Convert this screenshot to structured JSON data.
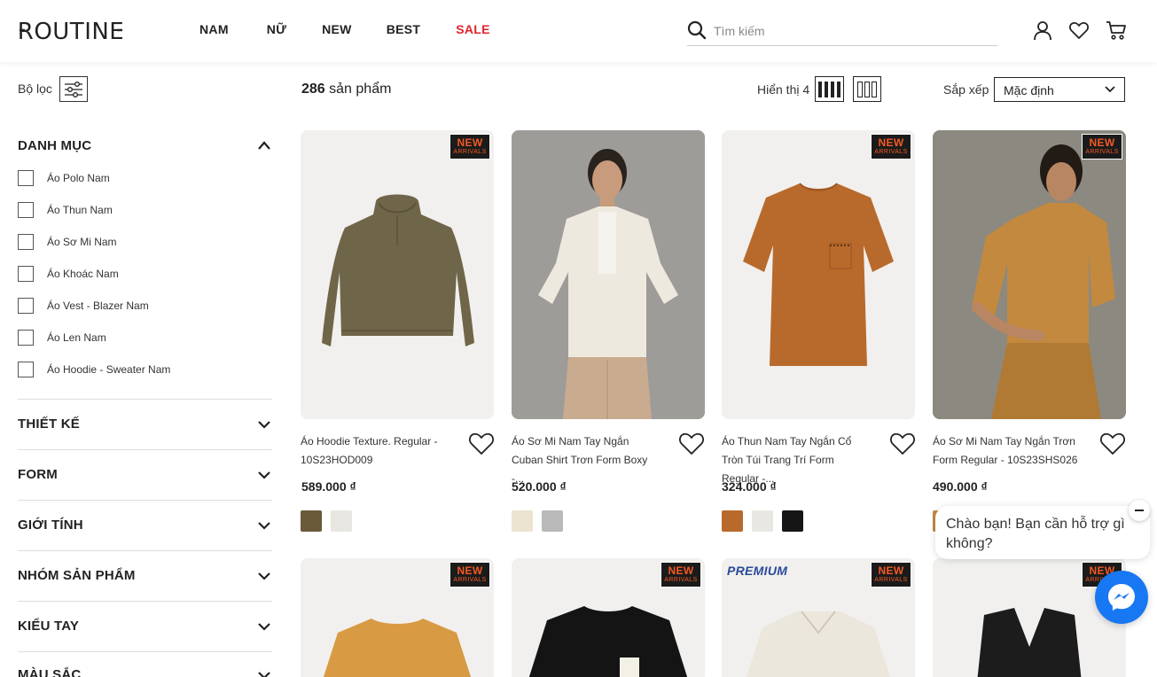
{
  "header": {
    "logo": "ROUTINE",
    "nav": [
      {
        "label": "NAM"
      },
      {
        "label": "NỮ"
      },
      {
        "label": "NEW"
      },
      {
        "label": "BEST"
      },
      {
        "label": "SALE",
        "color": "#e0242c"
      }
    ],
    "search_placeholder": "Tìm kiếm"
  },
  "toolbar": {
    "filter_label": "Bộ lọc",
    "count_number": "286",
    "count_suffix": " sản phẩm",
    "display_label": "Hiển thị 4",
    "sort_label": "Sắp xếp",
    "sort_value": "Mặc định"
  },
  "sidebar": {
    "category_title": "DANH MỤC",
    "categories": [
      {
        "label": "Áo Polo Nam"
      },
      {
        "label": "Áo Thun Nam"
      },
      {
        "label": "Áo Sơ Mi Nam"
      },
      {
        "label": "Áo Khoác Nam"
      },
      {
        "label": "Áo Vest - Blazer Nam"
      },
      {
        "label": "Áo Len Nam"
      },
      {
        "label": "Áo Hoodie - Sweater Nam"
      }
    ],
    "sections": [
      {
        "title": "THIẾT KẾ"
      },
      {
        "title": "FORM"
      },
      {
        "title": "GIỚI TÍNH"
      },
      {
        "title": "NHÓM SẢN PHẨM"
      },
      {
        "title": "KIỂU TAY"
      },
      {
        "title": "MÀU SẮC"
      }
    ]
  },
  "badge": {
    "line1": "NEW",
    "line2": "ARRIVALS",
    "premium": "PREMIUM"
  },
  "products": [
    {
      "name": "Áo Hoodie Texture. Regular - 10S23HOD009",
      "price": "589.000 ₫",
      "swatches": [
        "#6b5a3a",
        "#e8e6e1"
      ]
    },
    {
      "name": "Áo Sơ Mi Nam Tay Ngắn Cuban Shirt Trơn Form Boxy -...",
      "price": "520.000 ₫",
      "swatches": [
        "#ece3d0",
        "#b9b9b9"
      ]
    },
    {
      "name": "Áo Thun Nam Tay Ngắn Cổ Tròn Túi Trang Trí Form Regular -...",
      "price": "324.000 ₫",
      "swatches": [
        "#b86a2c",
        "#e9e7e1",
        "#151515"
      ]
    },
    {
      "name": "Áo Sơ Mi Nam Tay Ngắn Trơn Form Regular - 10S23SHS026",
      "price": "490.000 ₫",
      "swatches": [
        "#c08a45"
      ]
    }
  ],
  "chat": {
    "message": "Chào bạn! Bạn cần hỗ trợ gì không?"
  }
}
